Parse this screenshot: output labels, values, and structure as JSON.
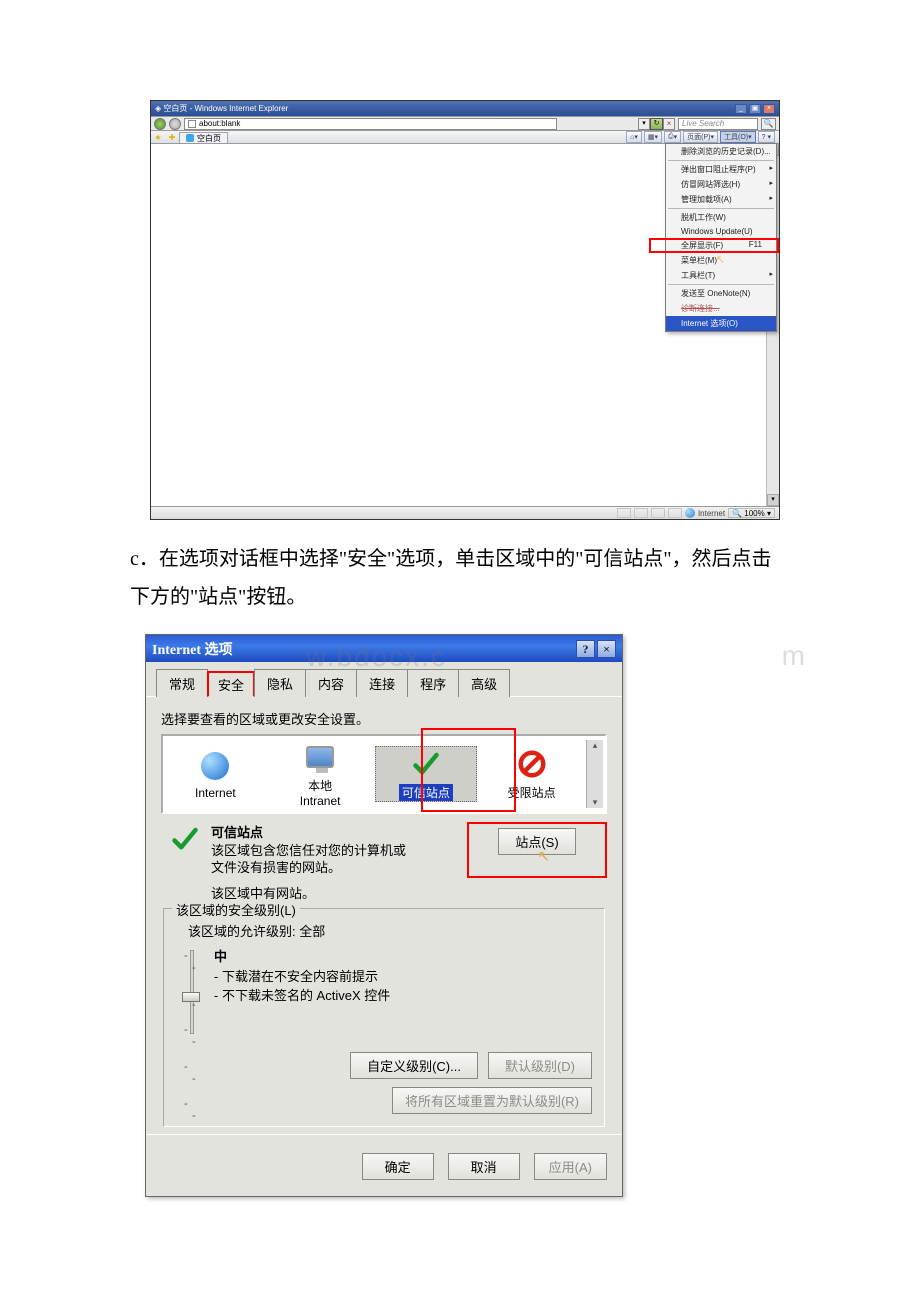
{
  "ie": {
    "title_prefix": "空白页",
    "title_app": " - Windows Internet Explorer",
    "url": "about:blank",
    "search_placeholder": "Live Search",
    "tab_label": "空白页",
    "toolbar": {
      "page": "页面(P)",
      "tools": "工具(O)",
      "home_icon": "⌂",
      "feed_icon": "▦",
      "print_icon": "⎙"
    },
    "menu": {
      "history": "删除浏览的历史记录(D)...",
      "popup": "弹出窗口阻止程序(P)",
      "phishing": "仿冒网站筛选(H)",
      "addons": "管理加载项(A)",
      "offline": "脱机工作(W)",
      "winupdate": "Windows Update(U)",
      "fullscreen": "全屏显示(F)",
      "fullscreen_key": "F11",
      "menubar": "菜单栏(M)",
      "toolbars": "工具栏(T)",
      "sendto": "发送至 OneNote(N)",
      "diag": "诊断连接...",
      "inetopt": "Internet 选项(O)"
    },
    "status": {
      "zone": "Internet",
      "zoom": "100%"
    }
  },
  "instruction": "c．在选项对话框中选择\"安全\"选项，单击区域中的\"可信站点\"，然后点击下方的\"站点\"按钮。",
  "dlg": {
    "title": "Internet 选项",
    "watermark": "w.bdocx.c",
    "watermark2": "m",
    "tabs": {
      "general": "常规",
      "security": "安全",
      "privacy": "隐私",
      "content": "内容",
      "connections": "连接",
      "programs": "程序",
      "advanced": "高级"
    },
    "select_label": "选择要查看的区域或更改安全设置。",
    "zones": {
      "internet": "Internet",
      "intranet_top": "本地",
      "intranet_bot": "Intranet",
      "trusted": "可信站点",
      "restricted": "受限站点"
    },
    "info": {
      "heading": "可信站点",
      "line1": "该区域包含您信任对您的计算机或",
      "line2": "文件没有损害的网站。",
      "has_sites": "该区域中有网站。"
    },
    "sites_btn": "站点(S)",
    "group_legend": "该区域的安全级别(L)",
    "allowed": "该区域的允许级别: 全部",
    "level_name": "中",
    "level_b1": "- 下载潜在不安全内容前提示",
    "level_b2": "- 不下载未签名的 ActiveX 控件",
    "custom_btn": "自定义级别(C)...",
    "default_btn": "默认级别(D)",
    "resetall_btn": "将所有区域重置为默认级别(R)",
    "ok": "确定",
    "cancel": "取消",
    "apply": "应用(A)"
  }
}
